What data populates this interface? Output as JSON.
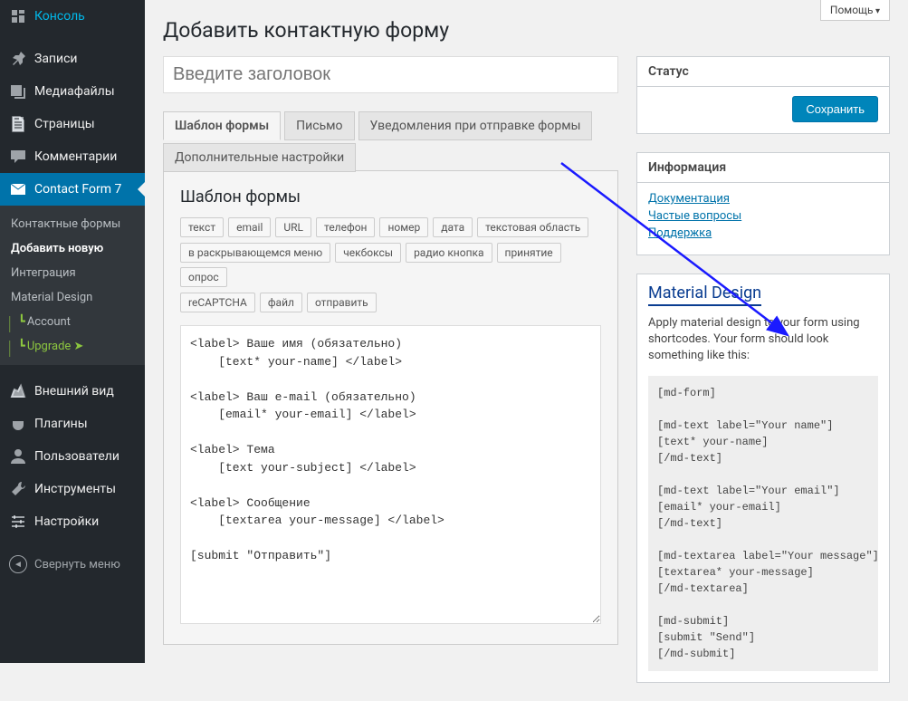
{
  "help_label": "Помощь",
  "page_title": "Добавить контактную форму",
  "title_placeholder": "Введите заголовок",
  "sidebar": {
    "items": [
      {
        "label": "Консоль",
        "icon": "dashboard"
      },
      {
        "label": "Записи",
        "icon": "pin"
      },
      {
        "label": "Медиафайлы",
        "icon": "media"
      },
      {
        "label": "Страницы",
        "icon": "page"
      },
      {
        "label": "Комментарии",
        "icon": "comment"
      },
      {
        "label": "Contact Form 7",
        "icon": "mail",
        "current": true
      },
      {
        "label": "Внешний вид",
        "icon": "appearance"
      },
      {
        "label": "Плагины",
        "icon": "plugin"
      },
      {
        "label": "Пользователи",
        "icon": "user"
      },
      {
        "label": "Инструменты",
        "icon": "tools"
      },
      {
        "label": "Настройки",
        "icon": "settings"
      }
    ],
    "submenu": [
      {
        "label": "Контактные формы"
      },
      {
        "label": "Добавить новую",
        "current": true
      },
      {
        "label": "Интеграция"
      },
      {
        "label": "Material Design"
      },
      {
        "label": "Account",
        "indent": true
      },
      {
        "label": "Upgrade  ➤",
        "indent": true,
        "upgrade": true
      }
    ],
    "collapse": "Свернуть меню"
  },
  "tabs": [
    {
      "label": "Шаблон формы",
      "active": true
    },
    {
      "label": "Письмо"
    },
    {
      "label": "Уведомления при отправке формы"
    }
  ],
  "tabs2": [
    {
      "label": "Дополнительные настройки"
    }
  ],
  "form_panel": {
    "heading": "Шаблон формы",
    "tag_buttons_row1": [
      "текст",
      "email",
      "URL",
      "телефон",
      "номер",
      "дата",
      "текстовая область"
    ],
    "tag_buttons_row2": [
      "в раскрывающемся меню",
      "чекбоксы",
      "радио кнопка",
      "принятие",
      "опрос"
    ],
    "tag_buttons_row3": [
      "reCAPTCHA",
      "файл",
      "отправить"
    ],
    "content": "<label> Ваше имя (обязательно)\n    [text* your-name] </label>\n\n<label> Ваш e-mail (обязательно)\n    [email* your-email] </label>\n\n<label> Тема\n    [text your-subject] </label>\n\n<label> Сообщение\n    [textarea your-message] </label>\n\n[submit \"Отправить\"]"
  },
  "status_box": {
    "title": "Статус",
    "save": "Сохранить"
  },
  "info_box": {
    "title": "Информация",
    "links": [
      "Документация",
      "Частые вопросы",
      "Поддержка"
    ]
  },
  "md_box": {
    "title": "Material Design",
    "desc": "Apply material design to your form using shortcodes. Your form should look something like this:",
    "code": "[md-form]\n\n[md-text label=\"Your name\"]\n[text* your-name]\n[/md-text]\n\n[md-text label=\"Your email\"]\n[email* your-email]\n[/md-text]\n\n[md-textarea label=\"Your message\"]\n[textarea* your-message]\n[/md-textarea]\n\n[md-submit]\n[submit \"Send\"]\n[/md-submit]"
  },
  "arrow_color": "#1a1aff"
}
